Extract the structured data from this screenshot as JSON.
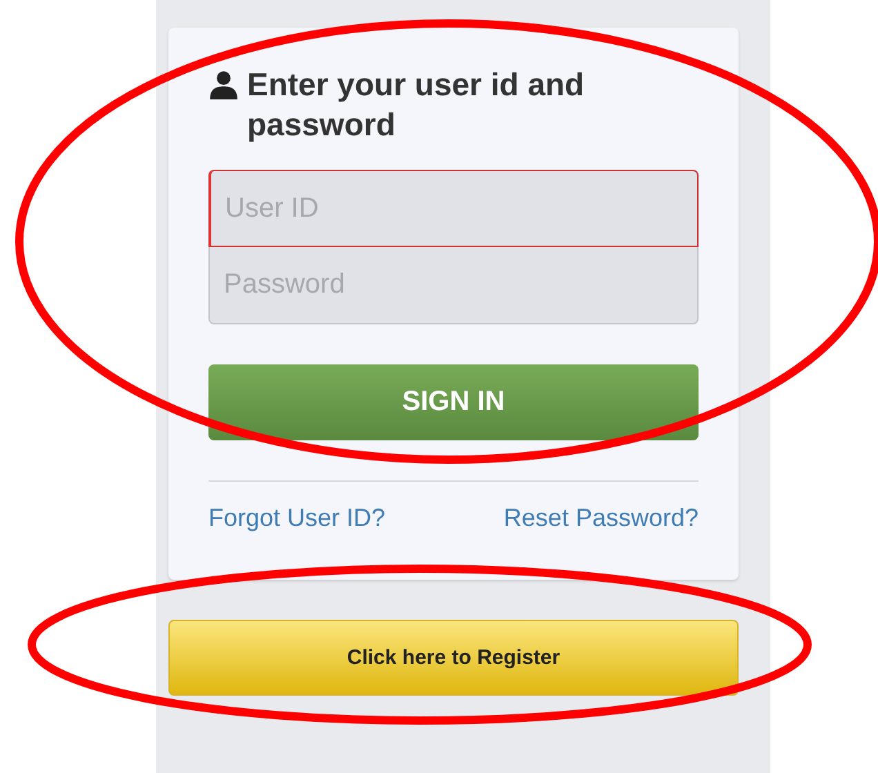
{
  "login": {
    "heading": "Enter your user id and password",
    "fields": [
      {
        "placeholder": "User ID",
        "invalid": true
      },
      {
        "placeholder": "Password",
        "invalid": false
      }
    ],
    "sign_in_button": "SIGN IN",
    "links": [
      "Forgot User ID?",
      "Reset Password?"
    ]
  },
  "register_button": "Click here to Register"
}
